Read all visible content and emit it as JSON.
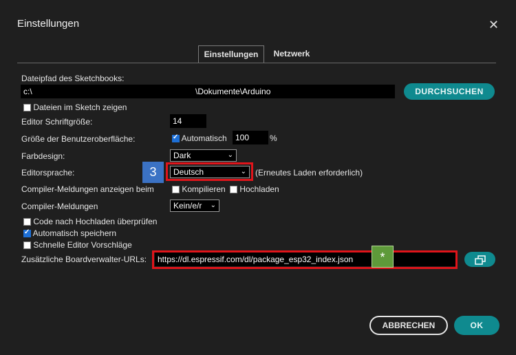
{
  "dialog": {
    "title": "Einstellungen"
  },
  "tabs": [
    {
      "label": "Einstellungen"
    },
    {
      "label": "Netzwerk"
    }
  ],
  "settings": {
    "sketchbook_label": "Dateipfad des Sketchbooks:",
    "sketchbook_path_prefix": "c:\\",
    "sketchbook_path_suffix": "\\Dokumente\\Arduino",
    "browse_label": "DURCHSUCHEN",
    "show_files_label": "Dateien im Sketch zeigen",
    "font_size_label": "Editor Schriftgröße:",
    "font_size_value": "14",
    "ui_scale_label": "Größe der Benutzeroberfläche:",
    "ui_scale_auto_label": "Automatisch",
    "ui_scale_value": "100",
    "ui_scale_unit": "%",
    "theme_label": "Farbdesign:",
    "theme_value": "Dark",
    "language_label": "Editorsprache:",
    "language_value": "Deutsch",
    "language_note": "(Erneutes Laden erforderlich)",
    "compiler_warnings_label": "Compiler-Meldungen anzeigen beim",
    "compile_label": "Kompilieren",
    "upload_label": "Hochladen",
    "compiler_messages_label": "Compiler-Meldungen",
    "compiler_messages_value": "Kein/e/r",
    "verify_label": "Code nach Hochladen überprüfen",
    "autosave_label": "Automatisch speichern",
    "quick_suggestions_label": "Schnelle Editor Vorschläge",
    "board_urls_label": "Zusätzliche Boardverwalter-URLs:",
    "board_urls_value": "https://dl.espressif.com/dl/package_esp32_index.json"
  },
  "checks": {
    "show_files": false,
    "ui_scale_auto": true,
    "compile": false,
    "upload": false,
    "verify": false,
    "autosave": true,
    "quick_suggestions": false
  },
  "annotations": {
    "step_badge": "3",
    "star_badge": "*"
  },
  "footer": {
    "cancel_label": "ABBRECHEN",
    "ok_label": "OK"
  },
  "colors": {
    "accent": "#0f8a8f",
    "highlight": "#e0141a",
    "badge_blue": "#3b72c4",
    "badge_green": "#5e9a3a"
  }
}
